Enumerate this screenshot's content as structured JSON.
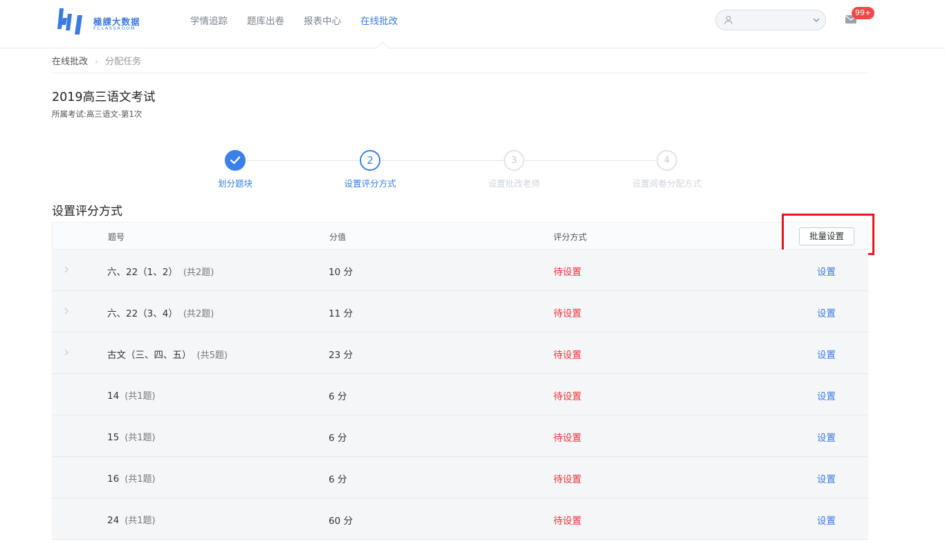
{
  "header": {
    "logo_title": "極課大数据",
    "logo_subtitle": "FCLASSROOM",
    "nav": [
      {
        "label": "学情追踪",
        "active": false
      },
      {
        "label": "题库出卷",
        "active": false
      },
      {
        "label": "报表中心",
        "active": false
      },
      {
        "label": "在线批改",
        "active": true
      }
    ],
    "user_select_value": "",
    "unread_badge": "99+"
  },
  "breadcrumb": {
    "root": "在线批改",
    "current": "分配任务"
  },
  "exam": {
    "title": "2019高三语文考试",
    "subtitle": "所属考试:高三语文-第1次"
  },
  "steps": [
    {
      "number": "",
      "label": "划分题块",
      "state": "done"
    },
    {
      "number": "2",
      "label": "设置评分方式",
      "state": "current"
    },
    {
      "number": "3",
      "label": "设置批改老师",
      "state": "todo"
    },
    {
      "number": "4",
      "label": "设置阅卷分配方式",
      "state": "todo"
    }
  ],
  "section_title": "设置评分方式",
  "table": {
    "headers": {
      "question": "题号",
      "score": "分值",
      "method": "评分方式"
    },
    "batch_button": "批量设置",
    "rows": [
      {
        "name": "六、22（1、2）",
        "count": "(共2题)",
        "score": "10 分",
        "status": "待设置",
        "action": "设置",
        "expandable": true
      },
      {
        "name": "六、22（3、4）",
        "count": "(共2题)",
        "score": "11 分",
        "status": "待设置",
        "action": "设置",
        "expandable": true
      },
      {
        "name": "古文（三、四、五）",
        "count": "(共5题)",
        "score": "23 分",
        "status": "待设置",
        "action": "设置",
        "expandable": true
      },
      {
        "name": "14",
        "count": "(共1题)",
        "score": "6 分",
        "status": "待设置",
        "action": "设置",
        "expandable": false
      },
      {
        "name": "15",
        "count": "(共1题)",
        "score": "6 分",
        "status": "待设置",
        "action": "设置",
        "expandable": false
      },
      {
        "name": "16",
        "count": "(共1题)",
        "score": "6 分",
        "status": "待设置",
        "action": "设置",
        "expandable": false
      },
      {
        "name": "24",
        "count": "(共1题)",
        "score": "60 分",
        "status": "待设置",
        "action": "设置",
        "expandable": false
      }
    ]
  },
  "colors": {
    "accent": "#3a80e8",
    "status_pending": "#e8363a",
    "highlight": "#e8141c",
    "badge": "#f04848"
  }
}
